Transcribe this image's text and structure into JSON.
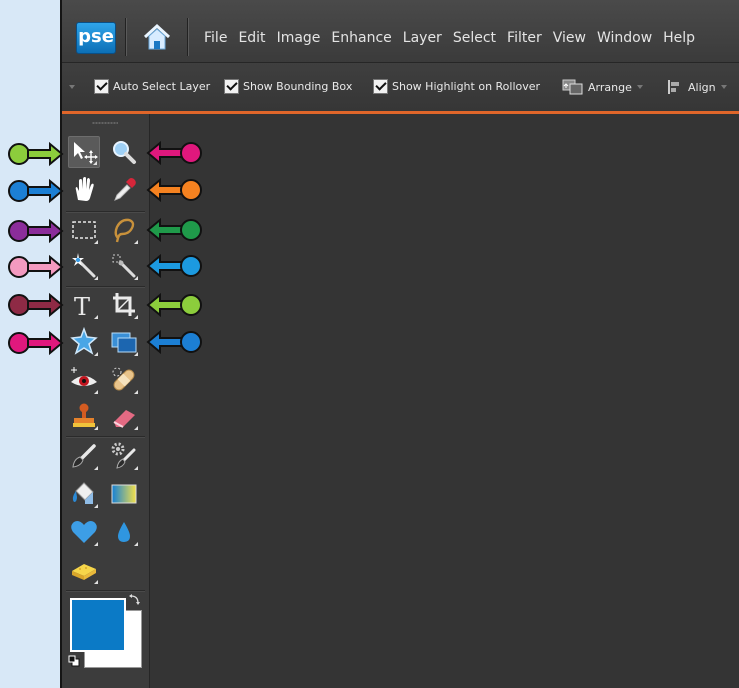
{
  "app": {
    "logo_text": "pse"
  },
  "menubar": {
    "items": [
      "File",
      "Edit",
      "Image",
      "Enhance",
      "Layer",
      "Select",
      "Filter",
      "View",
      "Window",
      "Help"
    ]
  },
  "options_bar": {
    "auto_select_layer": {
      "label": "Auto Select Layer",
      "checked": true
    },
    "show_bounding_box": {
      "label": "Show Bounding Box",
      "checked": true
    },
    "show_highlight": {
      "label": "Show Highlight on Rollover",
      "checked": true
    },
    "arrange_label": "Arrange",
    "align_label": "Align"
  },
  "toolbox": {
    "tools": [
      "move-tool",
      "zoom-tool",
      "hand-tool",
      "eyedropper-tool",
      "rectangular-marquee-tool",
      "lasso-tool",
      "magic-wand-tool",
      "quick-selection-tool",
      "type-tool",
      "crop-tool",
      "cookie-cutter-tool",
      "recompose-tool",
      "red-eye-removal-tool",
      "spot-healing-brush-tool",
      "clone-stamp-tool",
      "eraser-tool",
      "brush-tool",
      "smart-brush-tool",
      "paint-bucket-tool",
      "gradient-tool",
      "custom-shape-tool",
      "blur-tool",
      "sponge-tool"
    ],
    "foreground_color": "#0b7ac6",
    "background_color": "#ffffff"
  },
  "callouts": {
    "left_colors": [
      "#8ccd3c",
      "#1c7fd4",
      "#8b2d9a",
      "#f39ac0",
      "#8e2a45",
      "#e0187d"
    ],
    "right_colors": [
      "#e0187d",
      "#f58220",
      "#1f9a4a",
      "#1c9ae0",
      "#8ccd3c",
      "#1c7fd4"
    ]
  }
}
